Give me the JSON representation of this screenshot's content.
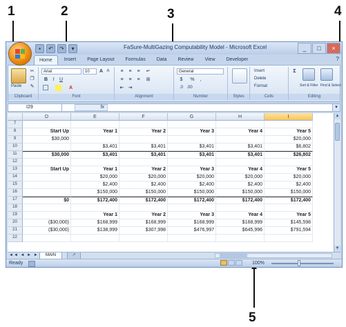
{
  "callouts": [
    "1",
    "2",
    "3",
    "4",
    "5"
  ],
  "window": {
    "title": "FaSure-MultiGazing Computability Model - Microsoft Excel",
    "controls": [
      "_",
      "□",
      "×"
    ],
    "qat": [
      "▪",
      "↶",
      "↷",
      "▾"
    ]
  },
  "ribbon": {
    "tabs": [
      "Home",
      "Insert",
      "Page Layout",
      "Formulas",
      "Data",
      "Review",
      "View",
      "Developer"
    ],
    "help": "?",
    "groups": {
      "clipboard": {
        "label": "Clipboard",
        "paste": "Paste"
      },
      "font": {
        "label": "Font",
        "name": "Arial",
        "size": "10",
        "bold": "B",
        "italic": "I",
        "underline": "U",
        "grow": "A",
        "shrink": "A"
      },
      "alignment": {
        "label": "Alignment"
      },
      "number": {
        "label": "Number",
        "format": "General",
        "currency": "$",
        "percent": "%",
        "comma": ","
      },
      "styles": {
        "label": "Styles"
      },
      "cells": {
        "label": "Cells",
        "insert": "Insert",
        "delete": "Delete",
        "format": "Format"
      },
      "editing": {
        "label": "Editing",
        "sum": "Σ",
        "sort": "Sort & Filter",
        "find": "Find & Select"
      }
    }
  },
  "formula": {
    "namebox": "I29",
    "fx": "fx"
  },
  "grid": {
    "columns": [
      "D",
      "E",
      "F",
      "G",
      "H",
      "I"
    ],
    "selected_column": "I",
    "rows": [
      {
        "n": "7",
        "c": [
          "",
          "",
          "",
          "",
          "",
          ""
        ]
      },
      {
        "n": "8",
        "c": [
          "Start Up",
          "Year 1",
          "Year 2",
          "Year 3",
          "Year 4",
          "Year 5"
        ]
      },
      {
        "n": "9",
        "c": [
          "$30,000",
          "",
          "",
          "",
          "",
          "$20,000"
        ]
      },
      {
        "n": "10",
        "c": [
          "",
          "$3,401",
          "$3,401",
          "$3,401",
          "$3,401",
          "$6,802"
        ]
      },
      {
        "n": "11",
        "c": [
          "$30,000",
          "$3,401",
          "$3,401",
          "$3,401",
          "$3,401",
          "$26,802"
        ]
      },
      {
        "n": "12",
        "c": [
          "",
          "",
          "",
          "",
          "",
          ""
        ]
      },
      {
        "n": "13",
        "c": [
          "Start Up",
          "Year 1",
          "Year 2",
          "Year 3",
          "Year 4",
          "Year 5"
        ]
      },
      {
        "n": "14",
        "c": [
          "",
          "$20,000",
          "$20,000",
          "$20,000",
          "$20,000",
          "$20,000"
        ]
      },
      {
        "n": "15",
        "c": [
          "",
          "$2,400",
          "$2,400",
          "$2,400",
          "$2,400",
          "$2,400"
        ]
      },
      {
        "n": "16",
        "c": [
          "",
          "$150,000",
          "$150,000",
          "$150,000",
          "$150,000",
          "$150,000"
        ]
      },
      {
        "n": "17",
        "c": [
          "$0",
          "$172,400",
          "$172,400",
          "$172,400",
          "$172,400",
          "$172,400"
        ]
      },
      {
        "n": "18",
        "c": [
          "",
          "",
          "",
          "",
          "",
          ""
        ]
      },
      {
        "n": "19",
        "c": [
          "",
          "Year 1",
          "Year 2",
          "Year 3",
          "Year 4",
          "Year 5"
        ]
      },
      {
        "n": "20",
        "c": [
          "($30,000)",
          "$168,999",
          "$168,999",
          "$168,999",
          "$168,999",
          "$145,598"
        ]
      },
      {
        "n": "21",
        "c": [
          "($30,000)",
          "$138,999",
          "$307,998",
          "$476,997",
          "$645,996",
          "$791,594"
        ]
      },
      {
        "n": "22",
        "c": [
          "",
          "",
          "",
          "",
          "",
          ""
        ]
      }
    ]
  },
  "sheets": {
    "nav": "◄◄ ◄ ► ►►",
    "active": "MAIN",
    "new": "↗"
  },
  "status": {
    "text": "Ready",
    "zoom": "100%"
  }
}
